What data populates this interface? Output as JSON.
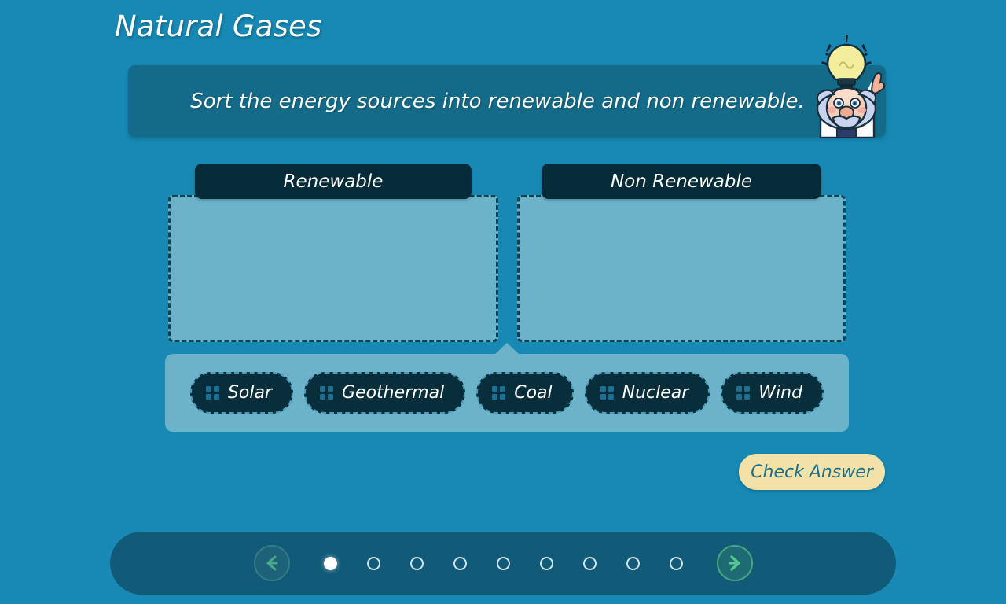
{
  "header": {
    "title": "Natural Gases"
  },
  "instruction": {
    "text": "Sort the energy sources into renewable and non renewable.",
    "mascot": "scientist-lightbulb-icon"
  },
  "categories": [
    {
      "id": "renewable",
      "label": "Renewable",
      "items": []
    },
    {
      "id": "non-renewable",
      "label": "Non Renewable",
      "items": []
    }
  ],
  "tray": {
    "chips": [
      {
        "label": "Solar"
      },
      {
        "label": "Geothermal"
      },
      {
        "label": "Coal"
      },
      {
        "label": "Nuclear"
      },
      {
        "label": "Wind"
      }
    ]
  },
  "actions": {
    "check_answer_label": "Check Answer"
  },
  "navigation": {
    "prev_icon": "arrow-left-icon",
    "next_icon": "arrow-right-icon",
    "total_steps": 9,
    "current_step": 1
  },
  "colors": {
    "background": "#1789b4",
    "banner": "#146b89",
    "header_chip": "#052b38",
    "drop_zone": "#6cb2c9",
    "tray": "#6cb2c9",
    "chip": "#082e3c",
    "check_button": "#f2e2a8",
    "check_button_text": "#1b6f8a",
    "nav_bar": "#115b79",
    "next_arrow": "#45a883"
  }
}
